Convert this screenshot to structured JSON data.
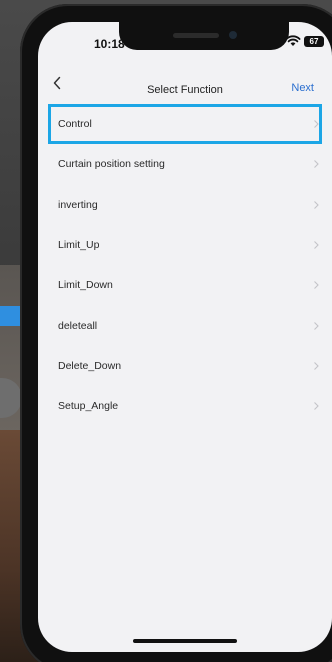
{
  "status_bar": {
    "time": "10:18",
    "battery": "67"
  },
  "nav": {
    "title": "Select Function",
    "next_label": "Next",
    "back_icon": "chevron-left-icon"
  },
  "functions": [
    {
      "label": "Control",
      "selected": true
    },
    {
      "label": "Curtain position setting",
      "selected": false
    },
    {
      "label": "inverting",
      "selected": false
    },
    {
      "label": "Limit_Up",
      "selected": false
    },
    {
      "label": "Limit_Down",
      "selected": false
    },
    {
      "label": "deleteall",
      "selected": false
    },
    {
      "label": "Delete_Down",
      "selected": false
    },
    {
      "label": "Setup_Angle",
      "selected": false
    }
  ],
  "colors": {
    "accent": "#2b6fcf",
    "highlight": "#1ca6e6",
    "background": "#f2f2f4"
  }
}
